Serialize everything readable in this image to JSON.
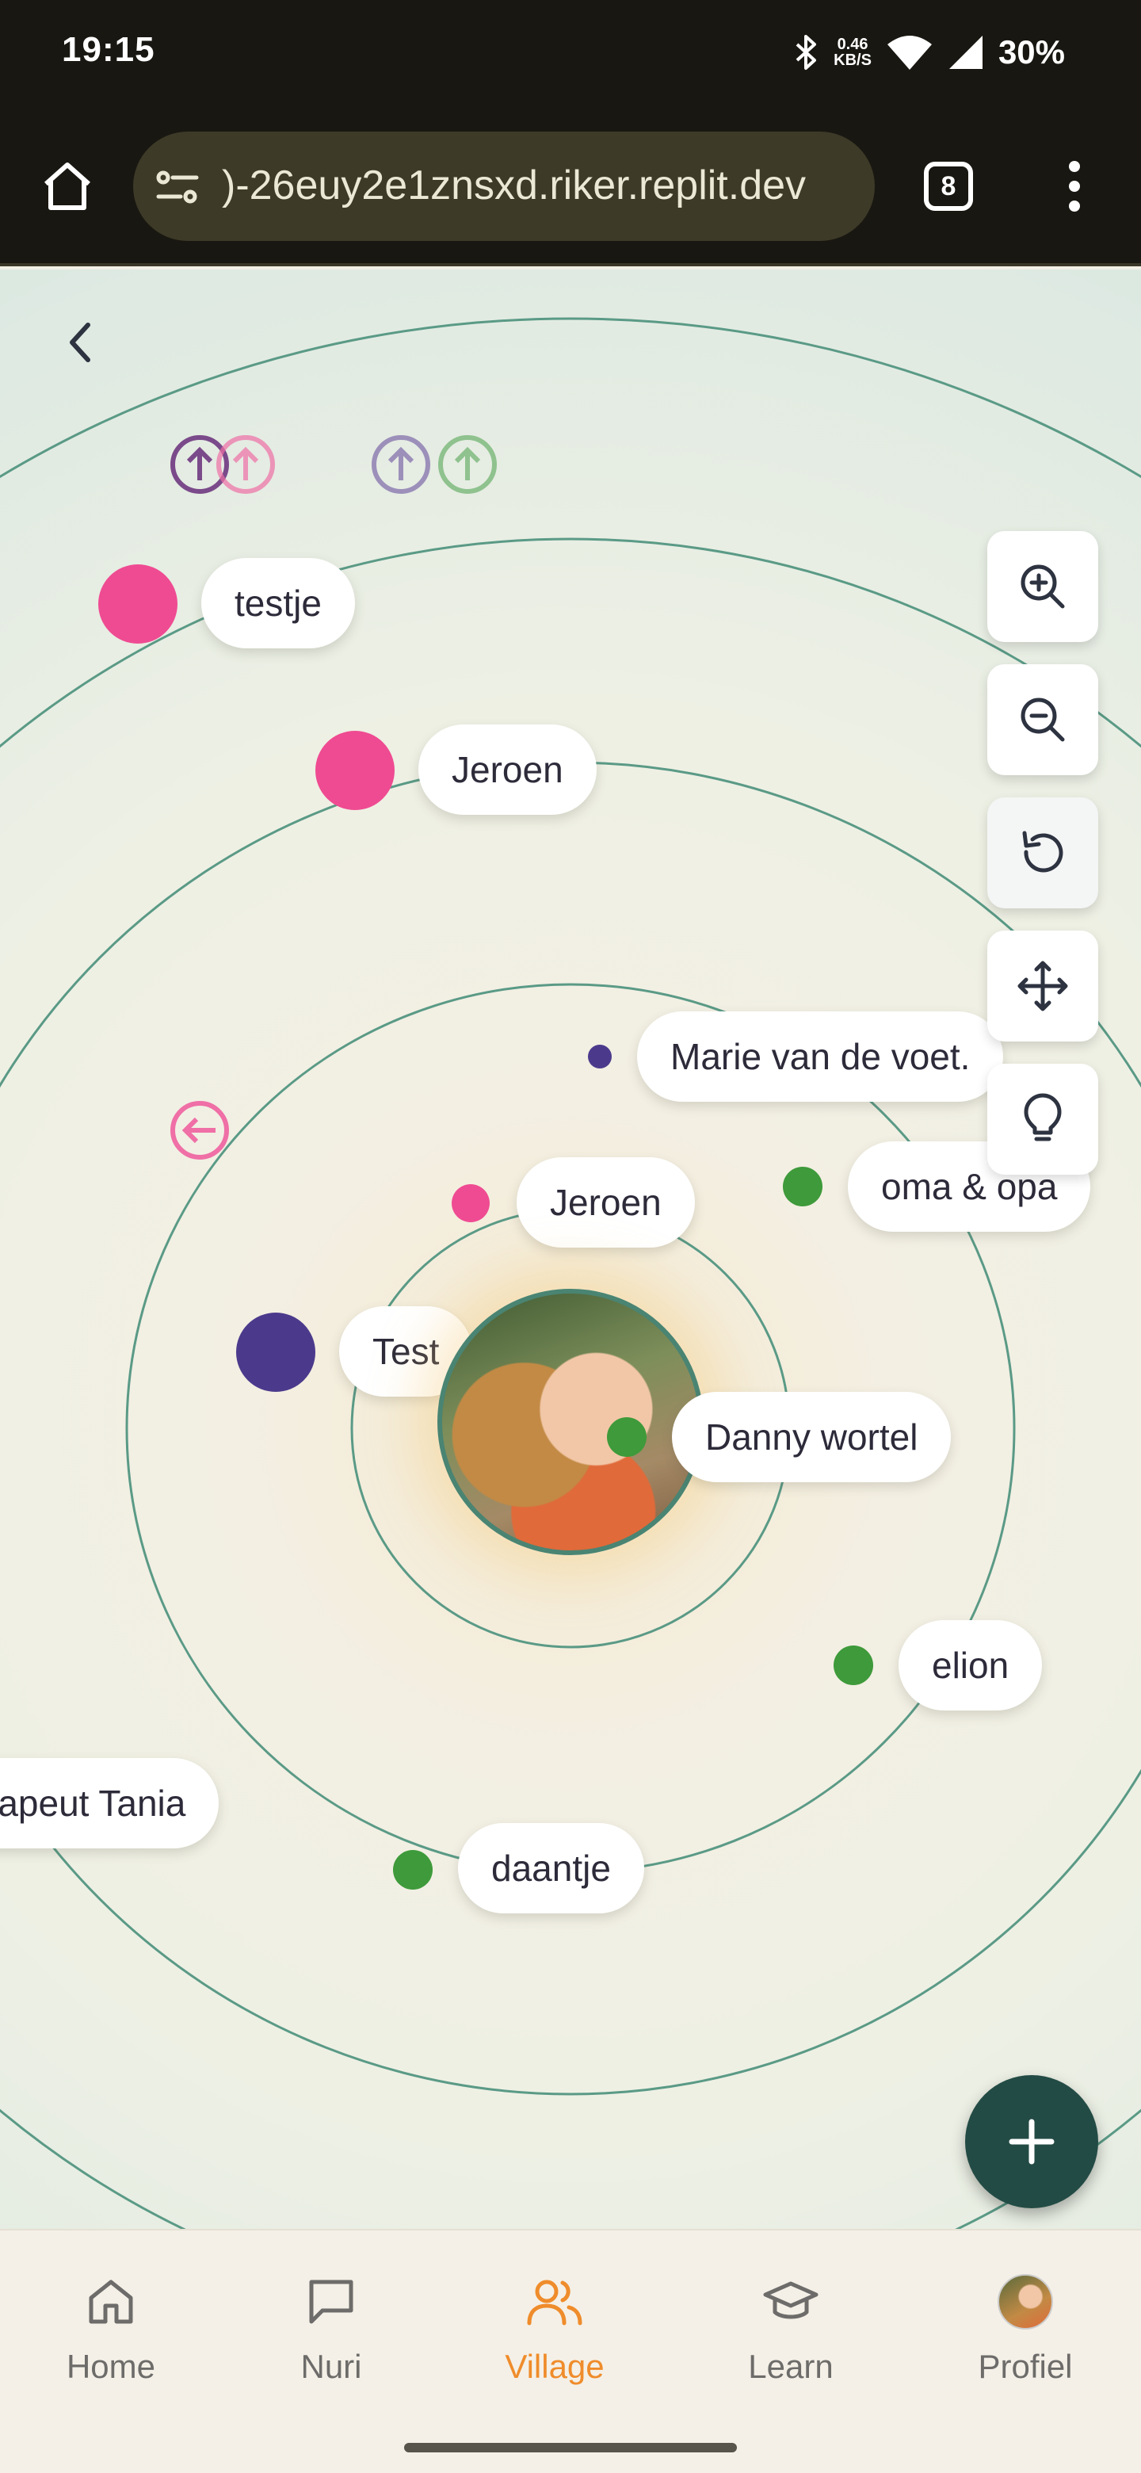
{
  "status_bar": {
    "time": "19:15",
    "network_speed_value": "0.46",
    "network_speed_unit": "KB/S",
    "battery": "30%"
  },
  "browser": {
    "url": ")-26euy2e1znsxd.riker.replit.dev",
    "tab_count": "8"
  },
  "map": {
    "people": [
      {
        "name": "testje",
        "color": "#ef4b92"
      },
      {
        "name": "Jeroen",
        "color": "#ef4b92"
      },
      {
        "name": "Marie van de voet.",
        "color": "#4b3a8c"
      },
      {
        "name": "oma & opa",
        "color": "#3e9a3a"
      },
      {
        "name": "Jeroen",
        "color": "#ef4b92"
      },
      {
        "name": "Test",
        "color": "#4b3a8c"
      },
      {
        "name": "Danny wortel",
        "color": "#3e9a3a"
      },
      {
        "name": "elion",
        "color": "#3e9a3a"
      },
      {
        "name": "rapeut Tania",
        "color": "#3e9a3a"
      },
      {
        "name": "daantje",
        "color": "#3e9a3a"
      }
    ],
    "controls": [
      "zoom-in",
      "zoom-out",
      "reset",
      "move",
      "hint"
    ]
  },
  "bottom_nav": {
    "items": [
      {
        "label": "Home",
        "icon": "home-icon"
      },
      {
        "label": "Nuri",
        "icon": "chat-icon"
      },
      {
        "label": "Village",
        "icon": "users-icon",
        "active": true
      },
      {
        "label": "Learn",
        "icon": "graduation-cap-icon"
      },
      {
        "label": "Profiel",
        "icon": "avatar"
      }
    ]
  },
  "colors": {
    "accent": "#ef8c2b",
    "ring": "#4a8472",
    "fab": "#234b45",
    "pink": "#ef4b92",
    "purple": "#4b3a8c",
    "green": "#3e9a3a"
  }
}
